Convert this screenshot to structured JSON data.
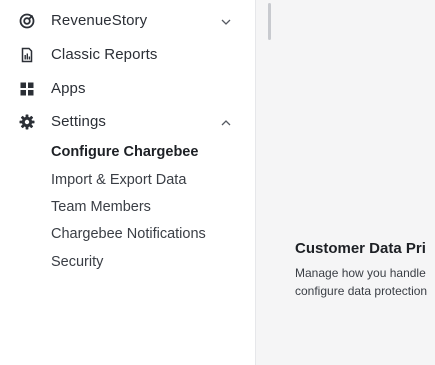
{
  "sidebar": {
    "items": [
      {
        "label": "RevenueStory",
        "icon": "revenue-story-icon",
        "chevron": "chevron-down-icon"
      },
      {
        "label": "Classic Reports",
        "icon": "report-document-icon"
      },
      {
        "label": "Apps",
        "icon": "apps-grid-icon"
      },
      {
        "label": "Settings",
        "icon": "gear-icon",
        "chevron": "chevron-up-icon"
      }
    ],
    "settings_submenu": [
      {
        "label": "Configure Chargebee",
        "active": true
      },
      {
        "label": "Import & Export Data",
        "active": false
      },
      {
        "label": "Team Members",
        "active": false
      },
      {
        "label": "Chargebee Notifications",
        "active": false
      },
      {
        "label": "Security",
        "active": false
      }
    ]
  },
  "main": {
    "card": {
      "title": "Customer Data Pri",
      "description_line1": "Manage how you handle",
      "description_line2": "configure data protection"
    }
  },
  "colors": {
    "icon": "#2b2f36",
    "main_background": "#f5f5f6",
    "sidebar_border": "#e6e7ea"
  }
}
